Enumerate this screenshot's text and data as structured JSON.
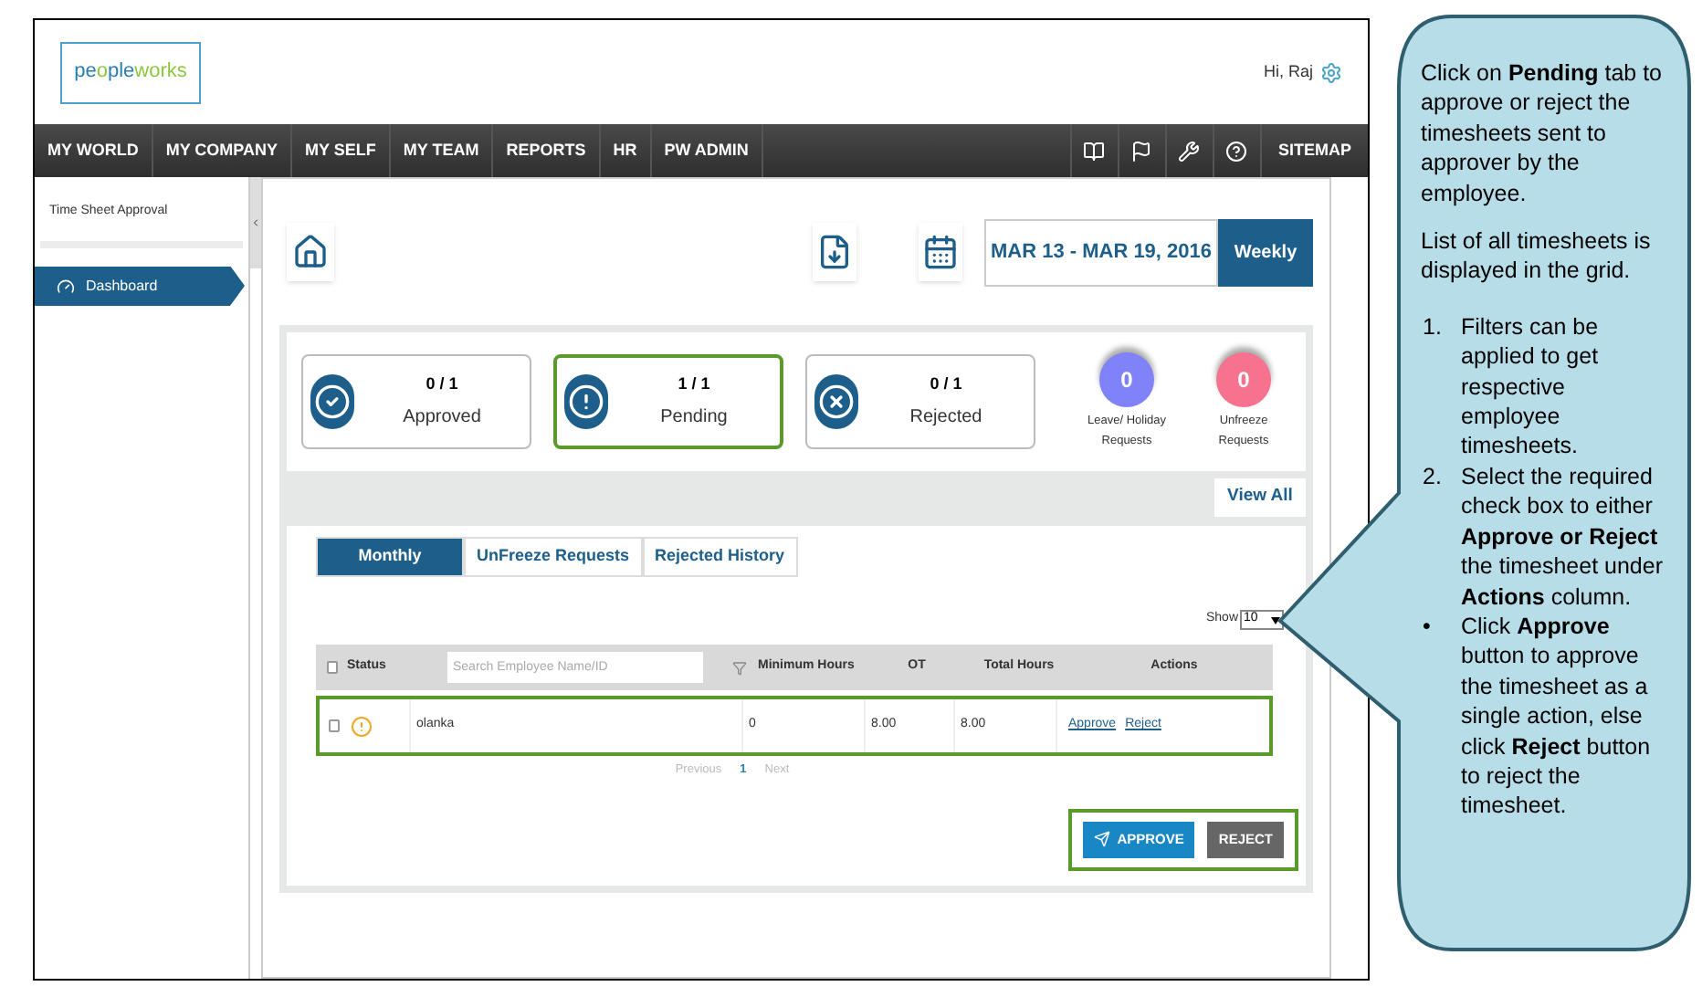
{
  "header": {
    "logo": [
      "pe",
      "o",
      "ple",
      "works"
    ],
    "greeting": "Hi, Raj"
  },
  "nav": {
    "items": [
      "MY WORLD",
      "MY COMPANY",
      "MY SELF",
      "MY TEAM",
      "REPORTS",
      "HR",
      "PW ADMIN"
    ],
    "sitemap": "SITEMAP"
  },
  "sidebar": {
    "title": "Time Sheet Approval",
    "items": [
      {
        "label": "Dashboard",
        "selected": true
      }
    ]
  },
  "date_range": "MAR 13 - MAR 19, 2016",
  "period_button": "Weekly",
  "summary_cards": [
    {
      "kind": "approved",
      "count": "0 / 1",
      "label": "Approved",
      "highlighted": false
    },
    {
      "kind": "pending",
      "count": "1 / 1",
      "label": "Pending",
      "highlighted": true
    },
    {
      "kind": "rejected",
      "count": "0 / 1",
      "label": "Rejected",
      "highlighted": false
    }
  ],
  "request_badges": [
    {
      "count": "0",
      "label": "Leave/ Holiday Requests",
      "color": "#7f82f8"
    },
    {
      "count": "0",
      "label": "Unfreeze Requests",
      "color": "#f7728f"
    }
  ],
  "view_all": "View All",
  "tabs": [
    {
      "label": "Monthly",
      "selected": true
    },
    {
      "label": "UnFreeze Requests",
      "selected": false
    },
    {
      "label": "Rejected History",
      "selected": false
    }
  ],
  "show": {
    "label": "Show",
    "value": "10"
  },
  "table": {
    "columns": [
      "Status",
      "Minimum Hours",
      "OT",
      "Total Hours",
      "Actions"
    ],
    "search_placeholder": "Search Employee Name/ID",
    "header_checked": false,
    "rows": [
      {
        "name": "olanka",
        "minimum_hours": "0",
        "ot": "8.00",
        "total_hours": "8.00",
        "actions": [
          "Approve",
          "Reject"
        ],
        "checked": false,
        "highlighted": true
      }
    ]
  },
  "pagination": {
    "previous": "Previous",
    "pages": [
      {
        "label": "1",
        "selected": true
      }
    ],
    "next": "Next"
  },
  "buttons": [
    {
      "kind": "approve",
      "label": "APPROVE"
    },
    {
      "kind": "reject",
      "label": "REJECT"
    }
  ],
  "buttons_highlighted": true,
  "callout": {
    "paragraphs": [
      "Click on **Pending** tab to approve or reject the timesheets sent to approver by the employee.",
      "List of all timesheets is displayed in the grid."
    ],
    "list": [
      {
        "marker": "1.",
        "text": "Filters can be applied to get respective employee timesheets."
      },
      {
        "marker": "2.",
        "text": "Select the required check box to either **Approve or Reject** the timesheet under **Actions** column."
      },
      {
        "marker": "•",
        "text": "Click **Approve** button to approve the timesheet as a single action, else click **Reject** button to reject the timesheet."
      }
    ]
  }
}
